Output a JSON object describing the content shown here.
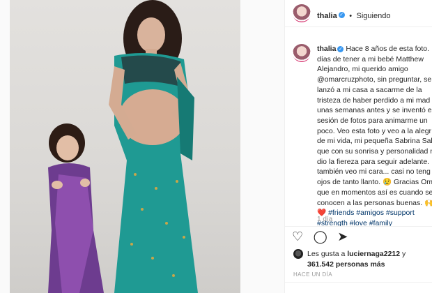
{
  "header": {
    "username": "thalia",
    "separator": "•",
    "follow_status": "Siguiendo"
  },
  "caption": {
    "username": "thalia",
    "text": "Hace 8 años de esta foto.\ndías de tener a mi bebé Matthew\nAlejandro, mi querido amigo\n@omarcruzphoto, sin preguntar, se\nlanzó a mi casa a sacarme de la\ntristeza de haber perdido a mi mad\nunas semanas antes y se inventó es\nsesión de fotos para animarme un\npoco. Veo esta foto y veo a la alegr\nde mi vida, mi pequeña Sabrina Sal\nque con su sonrisa y personalidad n\ndio la fiereza para seguir adelante.\ntambién veo mi cara... casi no teng\nojos de tanto llanto. 😢 Gracias Om\nque en momentos así es cuando se\nconocen a las personas buenas. 🙌",
    "hashtags_line1": "❤️ #friends #amigos #support",
    "hashtags_line2": "#strength #love #family",
    "time": "1 día"
  },
  "actions": {
    "like_icon": "heart-icon",
    "comment_icon": "comment-icon",
    "share_icon": "share-icon"
  },
  "likes": {
    "prefix": "Les gusta a ",
    "user": "luciernaga2212",
    "middle": " y",
    "count": "361.542 personas más"
  },
  "timestamp": "HACE UN DÍA"
}
